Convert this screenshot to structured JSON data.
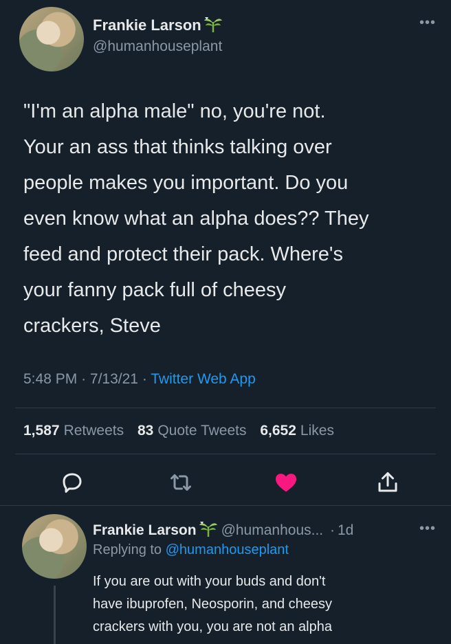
{
  "tweet": {
    "author_name": "Frankie Larson",
    "author_handle": "@humanhouseplant",
    "text_lines": [
      "\"I'm an alpha male\" no, you're not.",
      "Your an ass that thinks talking over",
      "people makes you important. Do you",
      "even know what an alpha does?? They",
      "feed and protect their pack. Where's",
      "your fanny pack full of cheesy",
      "crackers, Steve"
    ],
    "time": "5:48 PM",
    "date": "7/13/21",
    "app": "Twitter Web App",
    "stats": {
      "retweets_count": "1,587",
      "retweets_label": "Retweets",
      "quotes_count": "83",
      "quotes_label": "Quote Tweets",
      "likes_count": "6,652",
      "likes_label": "Likes"
    },
    "more_icon": "ellipsis-icon"
  },
  "actions": {
    "icons": [
      "reply-icon",
      "retweet-icon",
      "like-icon",
      "share-icon"
    ],
    "like_color": "#f91880"
  },
  "reply": {
    "author_name": "Frankie Larson",
    "author_handle": "@humanhous...",
    "age": "1d",
    "replying_prefix": "Replying to",
    "replying_to": "@humanhouseplant",
    "text_lines": [
      "If you are out with your buds and don't",
      "have ibuprofen, Neosporin, and cheesy",
      "crackers with you, you are not an alpha"
    ]
  },
  "colors": {
    "background": "#15202b",
    "link": "#1d9bf0",
    "secondary_text": "#8b98a5"
  }
}
